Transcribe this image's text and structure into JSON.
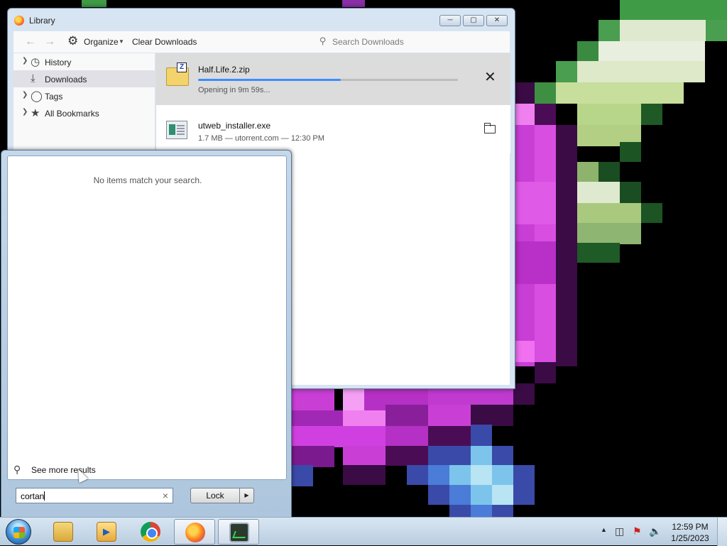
{
  "library": {
    "title": "Library",
    "toolbar": {
      "organize_label": "Organize",
      "clear_label": "Clear Downloads",
      "search_placeholder": "Search Downloads"
    },
    "sidebar": {
      "items": [
        {
          "label": "History",
          "icon": "clock-icon"
        },
        {
          "label": "Downloads",
          "icon": "download-icon",
          "selected": true
        },
        {
          "label": "Tags",
          "icon": "tag-icon"
        },
        {
          "label": "All Bookmarks",
          "icon": "star-icon"
        }
      ]
    },
    "downloads": [
      {
        "name": "Half.Life.2.zip",
        "status": "Opening in 9m 59s...",
        "progress": 0.55
      },
      {
        "name": "utweb_installer.exe",
        "status": "1.7 MB — utorrent.com — 12:30 PM"
      }
    ]
  },
  "startmenu": {
    "no_items": "No items match your search.",
    "see_more": "See more results",
    "search_value": "cortan",
    "lock_label": "Lock"
  },
  "taskbar": {
    "apps": [
      "explorer",
      "media-player",
      "chrome",
      "firefox",
      "task-manager"
    ],
    "clock": {
      "time": "12:59 PM",
      "date": "1/25/2023"
    }
  }
}
